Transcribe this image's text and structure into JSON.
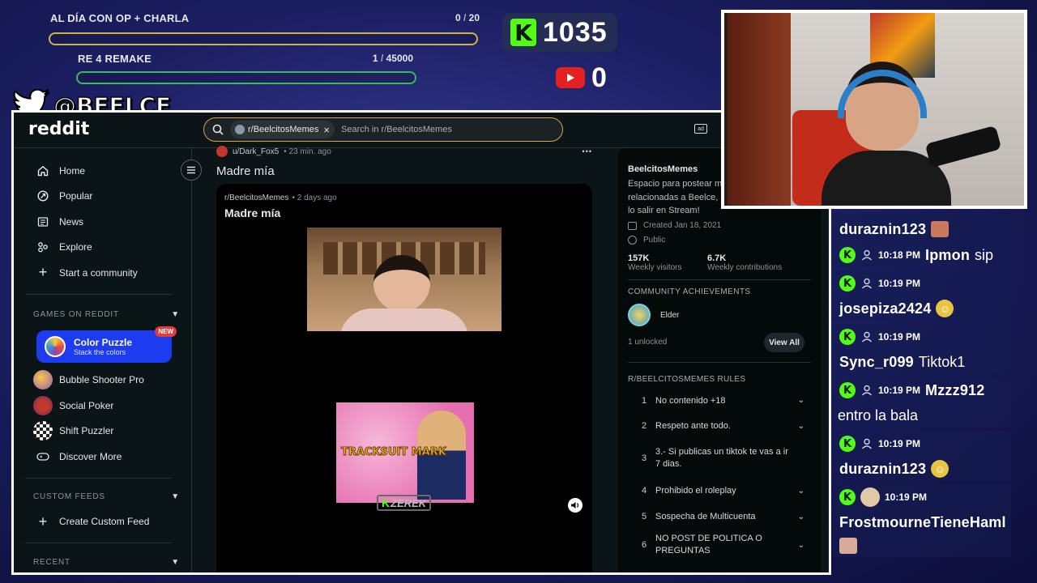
{
  "goals": [
    {
      "title": "AL DÍA CON OP + CHARLA",
      "current": "0",
      "sep": " / ",
      "target": "20",
      "progress": 0.0
    },
    {
      "title": "RE 4 REMAKE",
      "current": "1",
      "sep": " / ",
      "target": "45000",
      "progress": 0.0
    }
  ],
  "counters": {
    "kick": {
      "label": "K",
      "value": "1035"
    },
    "youtube": {
      "value": "0"
    }
  },
  "twitter_handle": "@BEELCE_",
  "reddit": {
    "logo": "reddit",
    "search": {
      "chip": "r/BeelcitosMemes",
      "chip_close": "×",
      "placeholder": "Search in r/BeelcitosMemes"
    },
    "nav": [
      {
        "label": "Home",
        "icon": "home-icon"
      },
      {
        "label": "Popular",
        "icon": "popular-icon"
      },
      {
        "label": "News",
        "icon": "news-icon"
      },
      {
        "label": "Explore",
        "icon": "explore-icon"
      },
      {
        "label": "Start a community",
        "icon": "plus-icon"
      }
    ],
    "games_header": "GAMES ON REDDIT",
    "featured_game": {
      "title": "Color Puzzle",
      "subtitle": "Stack the colors",
      "badge": "NEW"
    },
    "games": [
      {
        "label": "Bubble Shooter Pro"
      },
      {
        "label": "Social Poker"
      },
      {
        "label": "Shift Puzzler"
      },
      {
        "label": "Discover More"
      }
    ],
    "custom_feeds_header": "CUSTOM FEEDS",
    "create_feed": "Create Custom Feed",
    "recent_header": "RECENT",
    "post": {
      "author": "u/Dark_Fox5",
      "author_time": "• 23 min. ago",
      "more": "•••",
      "title": "Madre mía",
      "embed": {
        "sub": "r/BeelcitosMemes",
        "time": "• 2 days ago",
        "title": "Madre mía",
        "clip_text": "TRACKSUIT MARK",
        "watermark": "ZEREK"
      }
    },
    "about": {
      "name": "BeelcitosMemes",
      "desc": "Espacio para postear m relacionadas a Beelce, lo salir en Stream!",
      "created": "Created Jan 18, 2021",
      "visibility": "Public",
      "stats": [
        {
          "value": "157K",
          "label": "Weekly visitors"
        },
        {
          "value": "6.7K",
          "label": "Weekly contributions"
        }
      ],
      "achievements_header": "COMMUNITY ACHIEVEMENTS",
      "achievement": "Elder",
      "unlocked": "1 unlocked",
      "view_all": "View All",
      "rules_header": "R/BEELCITOSMEMES RULES",
      "rules": [
        {
          "n": "1",
          "text": "No contenido +18"
        },
        {
          "n": "2",
          "text": "Respeto ante todo."
        },
        {
          "n": "3",
          "text": "3.- Si publicas un tiktok te vas a ir 7 dias."
        },
        {
          "n": "4",
          "text": "Prohibido el roleplay"
        },
        {
          "n": "5",
          "text": "Sospecha de Multicuenta"
        },
        {
          "n": "6",
          "text": "NO POST DE POLITICA O PREGUNTAS"
        }
      ]
    }
  },
  "chat": [
    {
      "time": "",
      "user": "duraznin123",
      "msg": "",
      "emote": "face"
    },
    {
      "time": "10:18 PM",
      "user": "Ipmon",
      "msg": "sip",
      "emote": ""
    },
    {
      "time": "10:19 PM",
      "user": "josepiza2424",
      "msg": "",
      "emote": "grin"
    },
    {
      "time": "10:19 PM",
      "user": "Sync_r099",
      "msg": "Tiktok1",
      "emote": ""
    },
    {
      "time": "10:19 PM",
      "user": "Mzzz912",
      "msg": "entro la bala",
      "emote": ""
    },
    {
      "time": "10:19 PM",
      "user": "duraznin123",
      "msg": "",
      "emote": "grin"
    },
    {
      "time": "10:19 PM",
      "user": "FrostmourneTieneHaml",
      "msg": "",
      "emote": "face"
    }
  ],
  "colors": {
    "kick_green": "#53fc18",
    "reddit_bg": "#0b1416",
    "accent_orange": "#d9a53a"
  }
}
